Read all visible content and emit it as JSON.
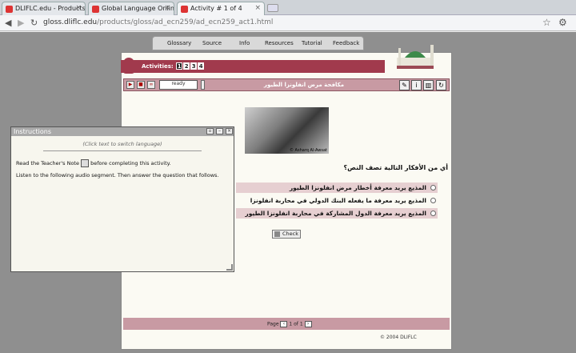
{
  "tabs": [
    {
      "label": "DLIFLC.edu - Products",
      "active": false
    },
    {
      "label": "Global Language Online",
      "active": false
    },
    {
      "label": "Activity # 1 of 4",
      "active": true
    }
  ],
  "address": {
    "domain": "gloss.dliflc.edu",
    "path": "/products/gloss/ad_ecn259/ad_ecn259_act1.html"
  },
  "menu": [
    "Glossary",
    "Source",
    "Info",
    "Resources",
    "Tutorial",
    "Feedback"
  ],
  "activities": {
    "label": "Activities:",
    "items": [
      "1",
      "2",
      "3",
      "4"
    ],
    "selected": 1
  },
  "player": {
    "status": "ready"
  },
  "content_title": "مكافحة مرض انفلونزا الطيور",
  "photo_caption": "© Asharq Al-Awsat",
  "question": "أي من الأفكار التالية تصف النص؟",
  "options": [
    "المذيع يريد معرفة أخطار مرض انفلونزا الطيور",
    "المذيع يريد معرفة ما يفعله البنك الدولي في محاربة انفلونزا الطيور",
    "المذيع يريد معرفة الدول المشاركة في محاربة انفلونزا الطيور"
  ],
  "check_label": "Check",
  "pager": {
    "page_label": "Page",
    "current": "1",
    "of_label": "of",
    "total": "1"
  },
  "copyright": "© 2004 DLIFLC",
  "instructions": {
    "title": "Instructions",
    "switch_text": "(Click text to switch language)",
    "line1_before": "Read the Teacher's Note",
    "line1_after": "before completing this activity.",
    "line2": "Listen to the following audio segment. Then answer the question that follows."
  },
  "colors": {
    "brand": "#a13a4d",
    "bar": "#c89aa3",
    "background": "#8f8f8f"
  }
}
